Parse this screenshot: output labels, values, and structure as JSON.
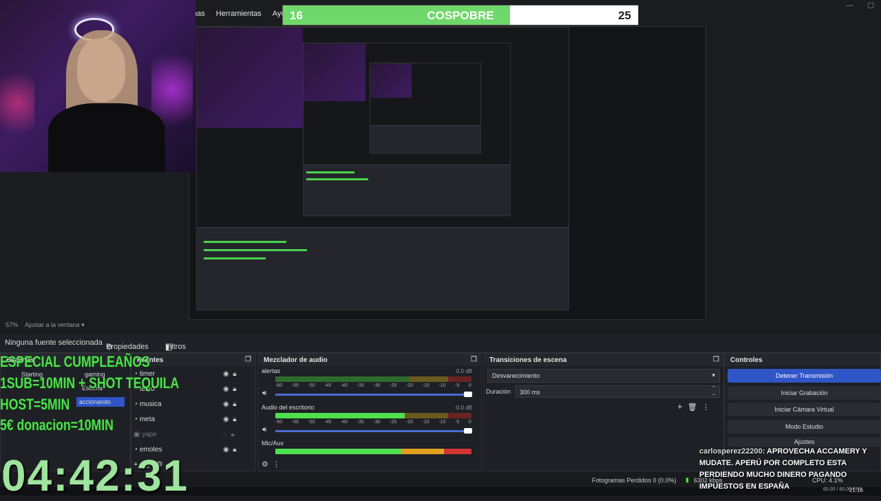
{
  "menu": {
    "items": [
      "nas",
      "Herramientas",
      "Ayuda (H"
    ]
  },
  "window_controls": [
    "—",
    "☐"
  ],
  "goal_bar": {
    "left": "16",
    "title": "COSPOBRE",
    "right": "25",
    "progress_fraction": 0.64
  },
  "zoom": {
    "value": "57%",
    "fit": "Ajustar a la ventana"
  },
  "properties": {
    "no_source": "Ninguna fuente seleccionada",
    "props": "Propiedades",
    "filters": "Filtros"
  },
  "scenes": {
    "header": "Escenas",
    "items": [
      "Starting",
      "gaming",
      "Escena",
      "accionando"
    ]
  },
  "sources": {
    "header": "Fuentes",
    "items": [
      "timer",
      "texto",
      "musica",
      "meta",
      "yape",
      "emotes"
    ]
  },
  "mixer": {
    "header": "Mezclador de audio",
    "tracks": [
      {
        "name": "alertas",
        "db": "0.0 dB"
      },
      {
        "name": "Audio del escritorio",
        "db": "-0.0 dB"
      },
      {
        "name": "Mic/Aux",
        "db": ""
      }
    ],
    "scale": [
      "-60",
      "-55",
      "-50",
      "-45",
      "-40",
      "-35",
      "-30",
      "-25",
      "-20",
      "-15",
      "-10",
      "-5",
      "0"
    ]
  },
  "transitions": {
    "header": "Transiciones de escena",
    "type": "Desvanecimiento",
    "duration_label": "Duración",
    "duration": "300 ms"
  },
  "controls": {
    "header": "Controles",
    "buttons": [
      "Detener Transmisión",
      "Iniciar Grabación",
      "Iniciar Cámara Virtual",
      "Modo Estudio",
      "Ajustes"
    ]
  },
  "overlay": {
    "lines": [
      "ESPECIAL CUMPLEAÑOS",
      "1SUB=10MIN + SHOT TEQUILA",
      "HOST=5MIN",
      "5€ donacion=10MIN"
    ],
    "timer": "04:42:31"
  },
  "chat": {
    "user": "carlosperez22200",
    "message": ": APROVECHA ACCAMERY Y MUDATE. APERÚ POR COMPLETO ESTA PERDIENDO MUCHO DINERO PAGANDO IMPUESTOS EN ESPAÑA"
  },
  "status": {
    "frames_lost": "Fotogramas Perdidos 0 (0.0%)",
    "kbps": "6302 kbps",
    "cpu": "CPU: 4.1%",
    "fps": "60.00 / 60.00 FPS",
    "time": "21:16"
  },
  "colors": {
    "goal_fill": "#6fd86a",
    "overlay_green": "#4ee04e",
    "primary_button": "#2f55c7"
  }
}
